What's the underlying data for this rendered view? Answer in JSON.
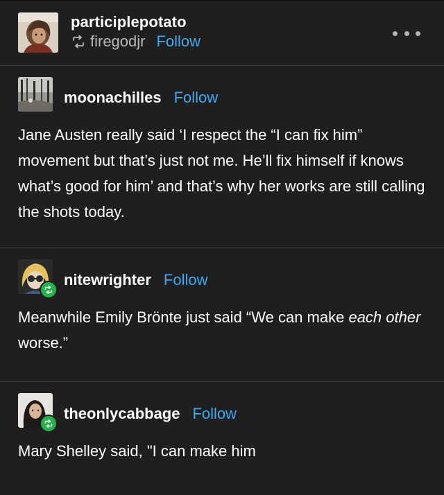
{
  "post": {
    "author": "participlepotato",
    "reblogged_from": "firegodjr",
    "follow_label": "Follow",
    "more_icon": "more-horizontal-icon"
  },
  "trail": [
    {
      "username": "moonachilles",
      "follow_label": "Follow",
      "text": "Jane Austen really said ‘I respect the “I can fix him” movement but that’s just not me. He’ll fix himself if knows what’s good for him’ and that’s why her works are still calling the shots today."
    },
    {
      "username": "nitewrighter",
      "follow_label": "Follow",
      "text_before": "Meanwhile Emily Brönte just said “We can make ",
      "text_italic_1": "each",
      "text_space": " ",
      "text_italic_2": "other",
      "text_after": " worse.”"
    },
    {
      "username": "theonlycabbage",
      "follow_label": "Follow",
      "text": "Mary Shelley said, \"I can make him"
    }
  ],
  "colors": {
    "background": "#1f1f1f",
    "link": "#3eaaf2",
    "reblog_badge": "#26b24b",
    "divider": "#3a3a3a"
  }
}
